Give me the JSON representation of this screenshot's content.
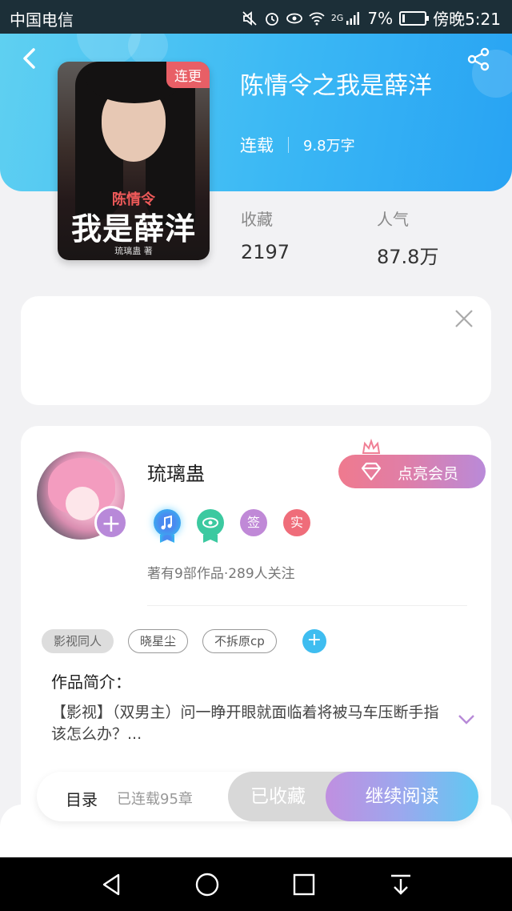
{
  "status_bar": {
    "carrier": "中国电信",
    "network": "2G",
    "battery": "7%",
    "time": "傍晚5:21"
  },
  "book": {
    "cover_badge": "连更",
    "cover_subtitle": "陈情令",
    "cover_title": "我是薛洋",
    "cover_author": "琉璃蛊 著",
    "title": "陈情令之我是薛洋",
    "status": "连载",
    "word_count": "9.8万字",
    "favorites_label": "收藏",
    "favorites_value": "2197",
    "popularity_label": "人气",
    "popularity_value": "87.8万"
  },
  "author": {
    "name": "琉璃蛊",
    "vip_button": "点亮会员",
    "badges": [
      {
        "name": "music-badge",
        "text": ""
      },
      {
        "name": "eye-badge",
        "text": ""
      },
      {
        "name": "sign-badge",
        "text": "签"
      },
      {
        "name": "real-badge",
        "text": "实"
      }
    ],
    "stats": "著有9部作品·289人关注",
    "tags": [
      "影视同人",
      "晓星尘",
      "不拆原cp"
    ],
    "tag_add": "+",
    "intro_title": "作品简介：",
    "intro_text": "【影视】（双男主）问一睁开眼就面临着将被马车压断手指该怎么办？..."
  },
  "action_bar": {
    "toc": "目录",
    "chapters": "已连载95章",
    "collected": "已收藏",
    "continue_read": "继续阅读"
  },
  "colors": {
    "header_start": "#5fd0f1",
    "header_end": "#28a3f3",
    "vip_start": "#ef7a8e",
    "vip_end": "#b98ad9",
    "read_start": "#c08fe0",
    "read_end": "#5fc9f2"
  }
}
